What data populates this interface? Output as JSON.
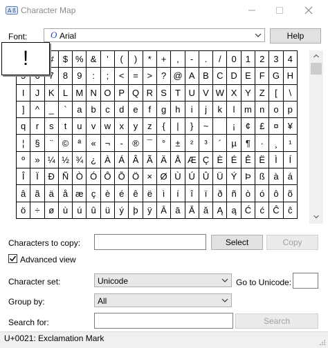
{
  "window": {
    "title": "Character Map"
  },
  "font": {
    "label": "Font:",
    "icon_glyph": "O",
    "value": "Arial"
  },
  "buttons": {
    "help": "Help",
    "select": "Select",
    "copy": "Copy",
    "search": "Search"
  },
  "grid": {
    "rows": [
      [
        "!",
        "\"",
        "#",
        "$",
        "%",
        "&",
        "'",
        "(",
        ")",
        "*",
        "+",
        ",",
        "-",
        ".",
        "/",
        "0",
        "1",
        "2",
        "3",
        "4"
      ],
      [
        "5",
        "6",
        "7",
        "8",
        "9",
        ":",
        ";",
        "<",
        "=",
        ">",
        "?",
        "@",
        "A",
        "B",
        "C",
        "D",
        "E",
        "F",
        "G",
        "H"
      ],
      [
        "I",
        "J",
        "K",
        "L",
        "M",
        "N",
        "O",
        "P",
        "Q",
        "R",
        "S",
        "T",
        "U",
        "V",
        "W",
        "X",
        "Y",
        "Z",
        "[",
        "\\"
      ],
      [
        "]",
        "^",
        "_",
        "`",
        "a",
        "b",
        "c",
        "d",
        "e",
        "f",
        "g",
        "h",
        "i",
        "j",
        "k",
        "l",
        "m",
        "n",
        "o",
        "p"
      ],
      [
        "q",
        "r",
        "s",
        "t",
        "u",
        "v",
        "w",
        "x",
        "y",
        "z",
        "{",
        "|",
        "}",
        "~",
        "",
        "¡",
        "¢",
        "£",
        "¤",
        "¥"
      ],
      [
        "¦",
        "§",
        "¨",
        "©",
        "ª",
        "«",
        "¬",
        "-",
        "®",
        "¯",
        "°",
        "±",
        "²",
        "³",
        "´",
        "µ",
        "¶",
        "·",
        "¸",
        "¹"
      ],
      [
        "º",
        "»",
        "¼",
        "½",
        "¾",
        "¿",
        "À",
        "Á",
        "Â",
        "Ã",
        "Ä",
        "Å",
        "Æ",
        "Ç",
        "È",
        "É",
        "Ê",
        "Ë",
        "Ì",
        "Í"
      ],
      [
        "Î",
        "Ï",
        "Ð",
        "Ñ",
        "Ò",
        "Ó",
        "Ô",
        "Õ",
        "Ö",
        "×",
        "Ø",
        "Ù",
        "Ú",
        "Û",
        "Ü",
        "Ý",
        "Þ",
        "ß",
        "à",
        "á"
      ],
      [
        "â",
        "ã",
        "ä",
        "å",
        "æ",
        "ç",
        "è",
        "é",
        "ê",
        "ë",
        "ì",
        "í",
        "î",
        "ï",
        "ð",
        "ñ",
        "ò",
        "ó",
        "ô",
        "õ"
      ],
      [
        "ö",
        "÷",
        "ø",
        "ù",
        "ú",
        "û",
        "ü",
        "ý",
        "þ",
        "ÿ",
        "Ā",
        "ā",
        "Ă",
        "ă",
        "Ą",
        "ą",
        "Ć",
        "ć",
        "Ĉ",
        "ĉ"
      ]
    ],
    "selected_char": "!"
  },
  "chars_to_copy": {
    "label": "Characters to copy:",
    "value": ""
  },
  "advanced_view": {
    "label": "Advanced view",
    "checked": true
  },
  "character_set": {
    "label": "Character set:",
    "value": "Unicode"
  },
  "go_to_unicode": {
    "label": "Go to Unicode:",
    "value": ""
  },
  "group_by": {
    "label": "Group by:",
    "value": "All"
  },
  "search_for": {
    "label": "Search for:",
    "value": ""
  },
  "status": {
    "text": "U+0021: Exclamation Mark"
  }
}
